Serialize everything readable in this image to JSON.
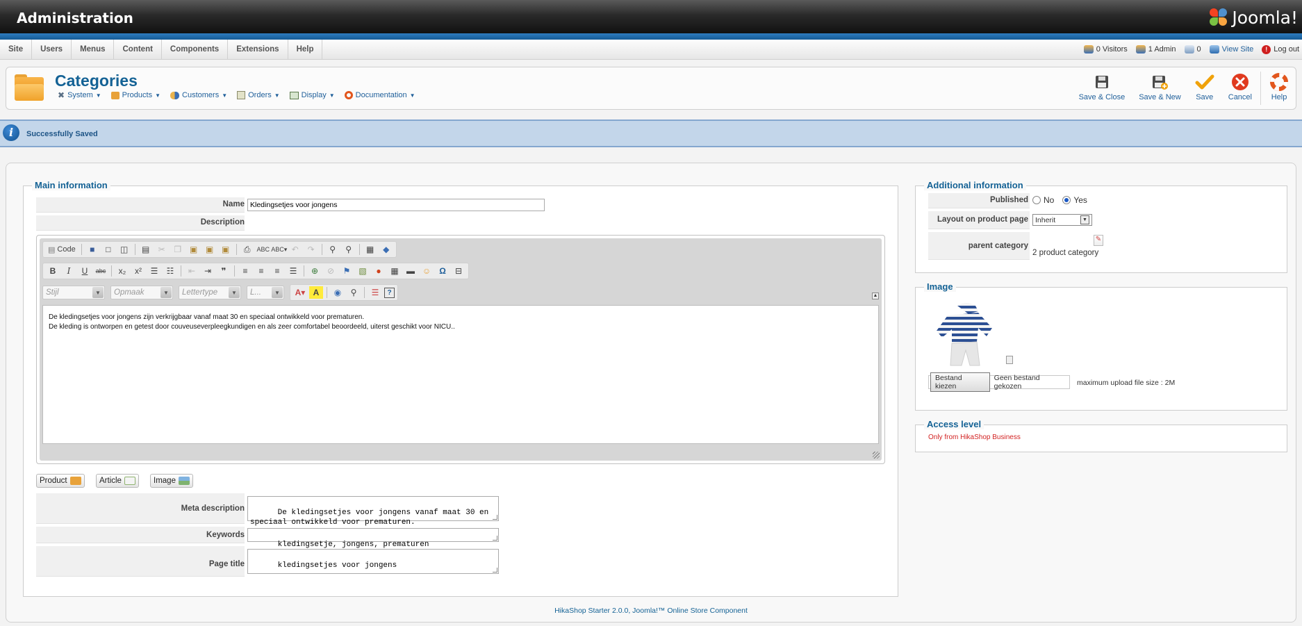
{
  "header": {
    "title": "Administration",
    "brand": "Joomla!",
    "brand_reg": "®"
  },
  "menu": {
    "items": [
      "Site",
      "Users",
      "Menus",
      "Content",
      "Components",
      "Extensions",
      "Help"
    ],
    "status": {
      "visitors": "0 Visitors",
      "admins": "1 Admin",
      "messages": "0",
      "view_site": "View Site",
      "logout": "Log out"
    }
  },
  "toolbar": {
    "page_title": "Categories",
    "submenu": [
      "System",
      "Products",
      "Customers",
      "Orders",
      "Display",
      "Documentation"
    ],
    "buttons": {
      "save_close": "Save & Close",
      "save_new": "Save & New",
      "save": "Save",
      "cancel": "Cancel",
      "help": "Help"
    }
  },
  "message": {
    "text": "Successfully Saved"
  },
  "main": {
    "legend": "Main information",
    "name_label": "Name",
    "name_value": "Kledingsetjes voor jongens",
    "description_label": "Description",
    "editor": {
      "code_label": "Code",
      "style_select": "Stijl",
      "format_select": "Opmaak",
      "font_select": "Lettertype",
      "size_select": "L...",
      "content_line1": "De kledingsetjes voor jongens zijn verkrijgbaar vanaf maat 30 en speciaal ontwikkeld voor prematuren.",
      "content_line2": "De kleding is ontworpen en getest door couveuseverpleegkundigen en als zeer comfortabel beoordeeld, uiterst geschikt voor NICU.."
    },
    "insert_buttons": {
      "product": "Product",
      "article": "Article",
      "image": "Image"
    },
    "meta_description_label": "Meta description",
    "meta_description_value": "De kledingsetjes voor jongens vanaf maat 30 en\nspeciaal ontwikkeld voor prematuren.",
    "keywords_label": "Keywords",
    "keywords_value": "kledingsetje, jongens, prematuren",
    "page_title_label": "Page title",
    "page_title_value": "kledingsetjes voor jongens"
  },
  "additional": {
    "legend": "Additional information",
    "published_label": "Published",
    "published_no": "No",
    "published_yes": "Yes",
    "published_value": "Yes",
    "layout_label": "Layout on product page",
    "layout_value": "Inherit",
    "parent_label": "parent category",
    "parent_value": "2 product category"
  },
  "image": {
    "legend": "Image",
    "file_button": "Bestand kiezen",
    "file_status": "Geen bestand gekozen",
    "max_size": "maximum upload file size : 2M"
  },
  "access": {
    "legend": "Access level",
    "text": "Only from HikaShop Business"
  },
  "footer": {
    "text": "HikaShop Starter 2.0.0, Joomla!™ Online Store Component"
  },
  "colors": {
    "accent": "#146295",
    "header_bg": "#1c1c1c",
    "message_bg": "#c3d6ea",
    "cancel": "#e03a1f",
    "save_check": "#f0a20a",
    "access_text": "#d22222"
  }
}
